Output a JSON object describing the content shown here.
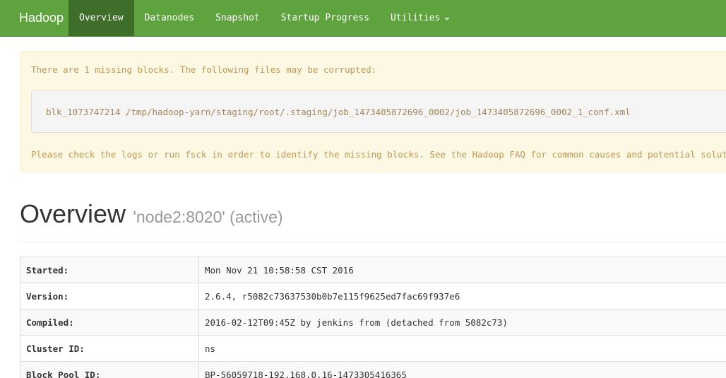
{
  "navbar": {
    "brand": "Hadoop",
    "items": [
      {
        "label": "Overview",
        "active": true
      },
      {
        "label": "Datanodes",
        "active": false
      },
      {
        "label": "Snapshot",
        "active": false
      },
      {
        "label": "Startup Progress",
        "active": false
      },
      {
        "label": "Utilities",
        "active": false,
        "dropdown": true
      }
    ]
  },
  "alert": {
    "line1": "There are 1 missing blocks. The following files may be corrupted:",
    "corrupt_file": "blk_1073747214 /tmp/hadoop-yarn/staging/root/.staging/job_1473405872696_0002/job_1473405872696_0002_1_conf.xml",
    "line2_prefix": "Please check the logs or run fsck in order to identify the missing blocks. See the ",
    "line2_link": "Hadoop FAQ",
    "line2_suffix": " for common causes and potential solutions."
  },
  "overview": {
    "title": "Overview",
    "subtitle": "'node2:8020' (active)"
  },
  "info_table": [
    {
      "key": "Started:",
      "value": "Mon Nov 21 10:58:58 CST 2016"
    },
    {
      "key": "Version:",
      "value": "2.6.4, r5082c73637530b0b7e115f9625ed7fac69f937e6"
    },
    {
      "key": "Compiled:",
      "value": "2016-02-12T09:45Z by jenkins from (detached from 5082c73)"
    },
    {
      "key": "Cluster ID:",
      "value": "ns"
    },
    {
      "key": "Block Pool ID:",
      "value": "BP-56059718-192.168.0.16-1473305416365"
    }
  ]
}
